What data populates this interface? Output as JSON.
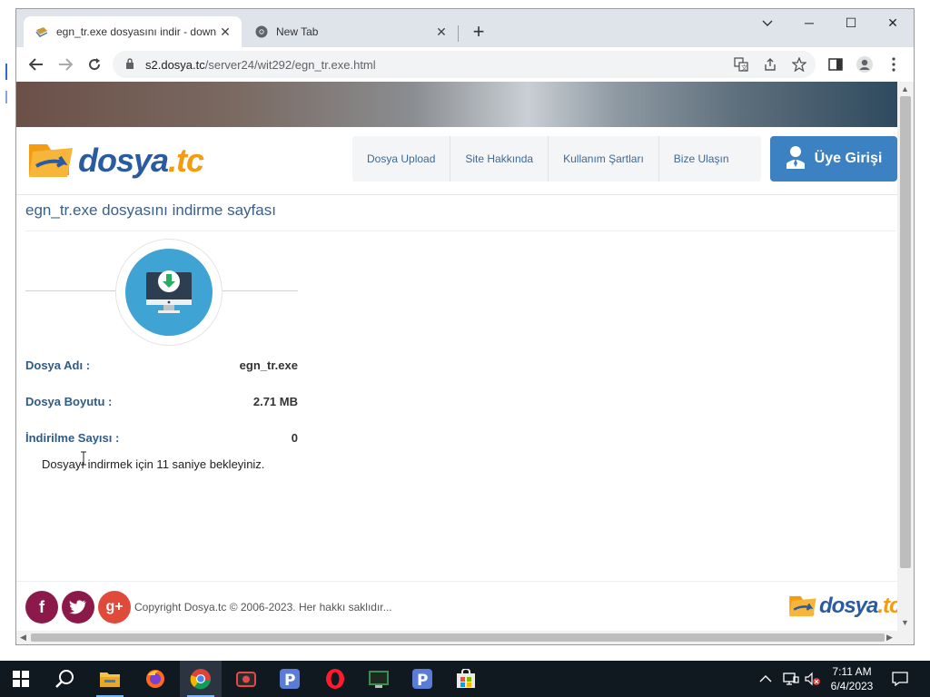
{
  "browser": {
    "tabs": [
      {
        "title": "egn_tr.exe dosyasını indir - down",
        "active": true
      },
      {
        "title": "New Tab",
        "active": false
      }
    ],
    "url_host": "s2.dosya.tc",
    "url_path": "/server24/wit292/egn_tr.exe.html"
  },
  "site": {
    "logo_text_main": "dosya",
    "logo_text_suffix": ".tc",
    "nav": [
      "Dosya Upload",
      "Site Hakkında",
      "Kullanım Şartları",
      "Bize Ulaşın"
    ],
    "login_label": "Üye Girişi",
    "page_title": "egn_tr.exe dosyasını indirme sayfası",
    "file_info": [
      {
        "label": "Dosya Adı :",
        "value": "egn_tr.exe"
      },
      {
        "label": "Dosya Boyutu :",
        "value": "2.71 MB"
      },
      {
        "label": "İndirilme Sayısı :",
        "value": "0"
      }
    ],
    "wait_message": "Dosyayı indirmek için 11 saniye bekleyiniz.",
    "copyright": "Copyright Dosya.tc © 2006-2023. Her hakkı saklıdır..."
  },
  "taskbar": {
    "time": "7:11 AM",
    "date": "6/4/2023",
    "apps": [
      "start",
      "search",
      "file-explorer",
      "firefox",
      "chrome",
      "camera-app",
      "p-app",
      "opera",
      "terminal-app",
      "p-app-2",
      "store"
    ]
  },
  "colors": {
    "brand_blue": "#2a5aa0",
    "brand_orange": "#f39c12",
    "login_bg": "#3c82c2",
    "label_blue": "#2f5b88"
  }
}
